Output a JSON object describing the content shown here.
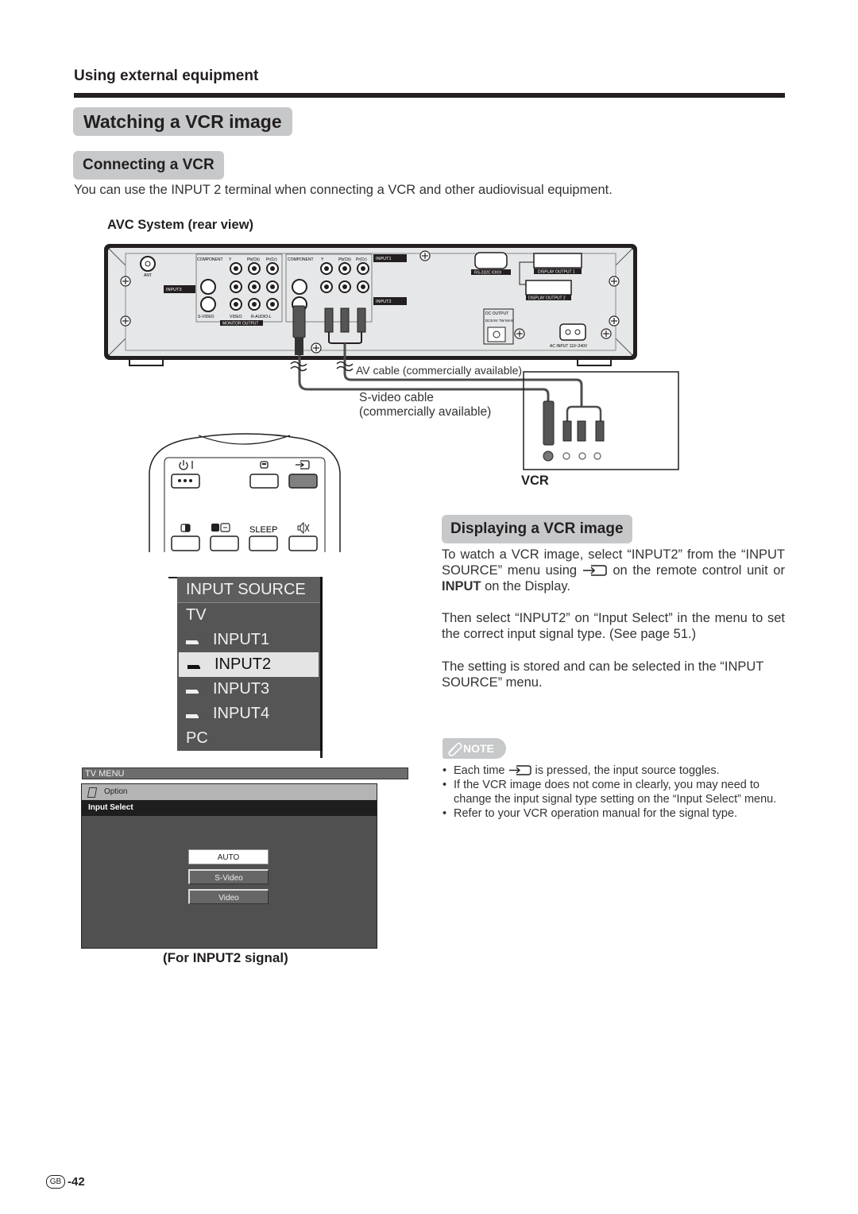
{
  "header": {
    "section": "Using external equipment",
    "title": "Watching a VCR image"
  },
  "connecting": {
    "heading": "Connecting a VCR",
    "intro": "You can use the INPUT 2 terminal when connecting a VCR and other audiovisual equipment.",
    "rear_view_label": "AVC System (rear view)",
    "panel_labels": {
      "ant": "ANT",
      "component": "COMPONENT",
      "y": "Y",
      "pb": "Pb(Cb)",
      "pr": "Pr(Cr)",
      "input1": "INPUT1",
      "input2": "INPUT2",
      "input3": "INPUT3",
      "svideo": "S-VIDEO",
      "video": "VIDEO",
      "audio": "R-AUDIO-L",
      "monitor_output": "MONITOR OUTPUT",
      "rs232c": "RS-232C",
      "display_output_1": "DISPLAY OUTPUT 1",
      "display_output_2": "DISPLAY OUTPUT 2",
      "dc_output": "DC OUTPUT",
      "dc_spec": "DC8.5V 7W MAX",
      "ac_input": "AC INPUT 110~240V"
    },
    "av_cable_label": "AV cable (commercially available)",
    "svideo_cable_label_1": "S-video cable",
    "svideo_cable_label_2": "(commercially available)",
    "vcr_label": "VCR"
  },
  "remote": {
    "power_label": "⏻ I",
    "sleep_label": "SLEEP"
  },
  "input_source_menu": {
    "title": "INPUT SOURCE",
    "items": [
      {
        "label": "TV",
        "icon": "",
        "selected": false
      },
      {
        "label": "INPUT1",
        "icon": "1",
        "selected": false
      },
      {
        "label": "INPUT2",
        "icon": "2",
        "selected": true
      },
      {
        "label": "INPUT3",
        "icon": "3",
        "selected": false
      },
      {
        "label": "INPUT4",
        "icon": "4",
        "selected": false
      },
      {
        "label": "PC",
        "icon": "",
        "selected": false
      }
    ]
  },
  "tv_menu": {
    "bar_title": "TV MENU",
    "option_label": "Option",
    "selected_label": "Input Select",
    "buttons": [
      {
        "label": "AUTO",
        "active": true
      },
      {
        "label": "S-Video",
        "active": false
      },
      {
        "label": "Video",
        "active": false
      }
    ],
    "caption": "(For INPUT2 signal)"
  },
  "displaying": {
    "heading": "Displaying a VCR image",
    "para1_a": "To watch a VCR image, select “INPUT2” from the “INPUT SOURCE” menu using",
    "para1_b": "on the remote control unit or",
    "para1_bold": "INPUT",
    "para1_c": "on the Display.",
    "para2": "Then select “INPUT2” on “Input Select” in the menu to set the correct input signal type. (See page 51.)",
    "para3": "The setting is stored and can be selected in the “INPUT SOURCE” menu."
  },
  "note": {
    "badge": "NOTE",
    "item1_a": "Each time",
    "item1_b": "is pressed, the input source toggles.",
    "item2": "If the VCR image does not come in clearly, you may need to change the input signal type setting on the “Input Select” menu.",
    "item3": "Refer to your VCR operation manual for the signal type."
  },
  "footer": {
    "region": "GB",
    "page": "-42"
  }
}
